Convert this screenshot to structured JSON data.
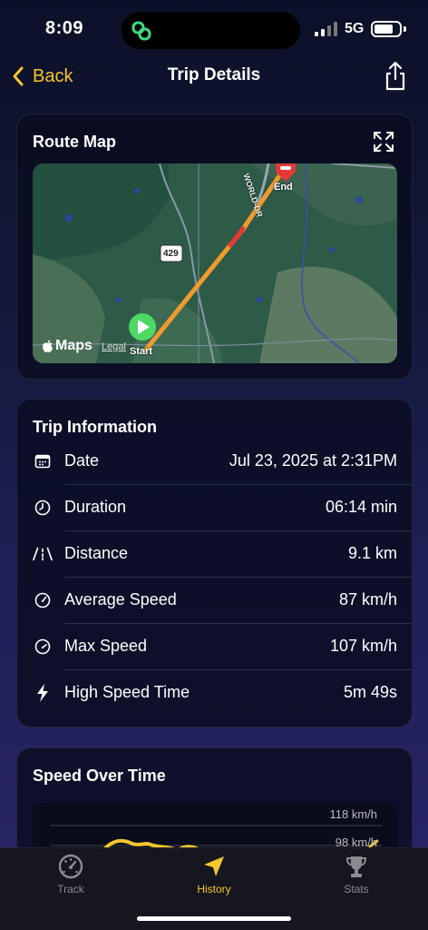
{
  "status": {
    "time": "8:09",
    "network": "5G"
  },
  "nav": {
    "back_label": "Back",
    "title": "Trip Details"
  },
  "route_map": {
    "title": "Route Map",
    "start_label": "Start",
    "end_label": "End",
    "road_shield": "429",
    "road_name": "WORLD-DR",
    "attribution": "Maps",
    "legal": "Legal"
  },
  "trip_info": {
    "title": "Trip Information",
    "rows": [
      {
        "icon": "calendar-icon",
        "label": "Date",
        "value": "Jul 23, 2025 at 2:31PM"
      },
      {
        "icon": "clock-icon",
        "label": "Duration",
        "value": "06:14 min"
      },
      {
        "icon": "road-icon",
        "label": "Distance",
        "value": "9.1 km"
      },
      {
        "icon": "gauge-icon",
        "label": "Average Speed",
        "value": "87 km/h"
      },
      {
        "icon": "gauge-max-icon",
        "label": "Max Speed",
        "value": "107 km/h"
      },
      {
        "icon": "bolt-icon",
        "label": "High Speed Time",
        "value": "5m 49s"
      }
    ]
  },
  "speed_chart": {
    "title": "Speed Over Time",
    "tick_labels": [
      "118 km/h",
      "98 km/h"
    ]
  },
  "tabs": [
    {
      "label": "Track",
      "icon": "speedometer-icon",
      "active": false
    },
    {
      "label": "History",
      "icon": "location-arrow-icon",
      "active": true
    },
    {
      "label": "Stats",
      "icon": "trophy-icon",
      "active": false
    }
  ],
  "colors": {
    "accent": "#f5c62c",
    "route": "#f39a2c",
    "start_pin": "#4cd964",
    "end_pin": "#e53935"
  }
}
